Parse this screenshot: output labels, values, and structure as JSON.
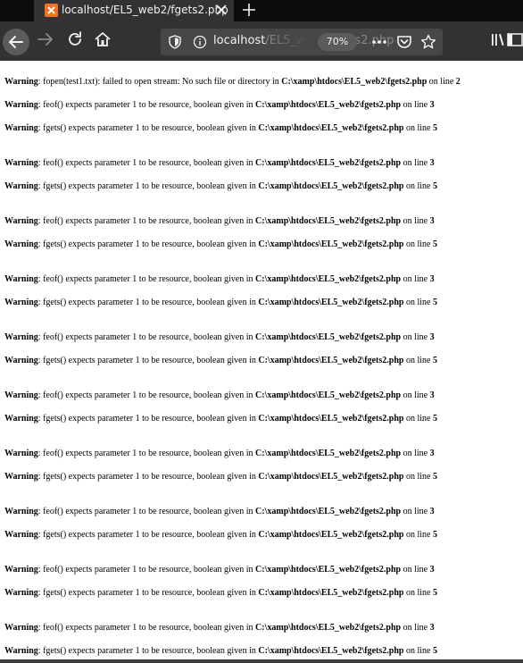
{
  "browser": {
    "tab": {
      "title": "localhost/EL5_web2/fgets2.php"
    },
    "url": {
      "host": "localhost",
      "path": "/EL5_web2/fgets2.php"
    },
    "zoom": "70%",
    "icons": {
      "tab_favicon": "xampp-favicon",
      "tab_close": "close-icon",
      "new_tab": "plus-icon",
      "back": "arrow-left-icon",
      "forward": "arrow-right-icon",
      "reload": "reload-icon",
      "home": "home-icon",
      "tracking": "shield-icon",
      "site_info": "info-icon",
      "page_actions": "more-icon",
      "pocket": "pocket-icon",
      "bookmark": "star-icon",
      "library": "library-icon",
      "sidebar": "sidebar-icon"
    }
  },
  "page": {
    "warnings": [
      {
        "label": "Warning",
        "message": ": fopen(test1.txt): failed to open stream: No such file or directory in ",
        "file": "C:\\xamp\\htdocs\\EL5_web2\\fgets2.php",
        "suffix": " on line ",
        "line": "2"
      },
      {
        "label": "Warning",
        "message": ": feof() expects parameter 1 to be resource, boolean given in ",
        "file": "C:\\xamp\\htdocs\\EL5_web2\\fgets2.php",
        "suffix": " on line ",
        "line": "3"
      },
      {
        "label": "Warning",
        "message": ": fgets() expects parameter 1 to be resource, boolean given in ",
        "file": "C:\\xamp\\htdocs\\EL5_web2\\fgets2.php",
        "suffix": " on line ",
        "line": "5"
      },
      {
        "label": "Warning",
        "message": ": feof() expects parameter 1 to be resource, boolean given in ",
        "file": "C:\\xamp\\htdocs\\EL5_web2\\fgets2.php",
        "suffix": " on line ",
        "line": "3"
      },
      {
        "label": "Warning",
        "message": ": fgets() expects parameter 1 to be resource, boolean given in ",
        "file": "C:\\xamp\\htdocs\\EL5_web2\\fgets2.php",
        "suffix": " on line ",
        "line": "5"
      },
      {
        "label": "Warning",
        "message": ": feof() expects parameter 1 to be resource, boolean given in ",
        "file": "C:\\xamp\\htdocs\\EL5_web2\\fgets2.php",
        "suffix": " on line ",
        "line": "3"
      },
      {
        "label": "Warning",
        "message": ": fgets() expects parameter 1 to be resource, boolean given in ",
        "file": "C:\\xamp\\htdocs\\EL5_web2\\fgets2.php",
        "suffix": " on line ",
        "line": "5"
      },
      {
        "label": "Warning",
        "message": ": feof() expects parameter 1 to be resource, boolean given in ",
        "file": "C:\\xamp\\htdocs\\EL5_web2\\fgets2.php",
        "suffix": " on line ",
        "line": "3"
      },
      {
        "label": "Warning",
        "message": ": fgets() expects parameter 1 to be resource, boolean given in ",
        "file": "C:\\xamp\\htdocs\\EL5_web2\\fgets2.php",
        "suffix": " on line ",
        "line": "5"
      },
      {
        "label": "Warning",
        "message": ": feof() expects parameter 1 to be resource, boolean given in ",
        "file": "C:\\xamp\\htdocs\\EL5_web2\\fgets2.php",
        "suffix": " on line ",
        "line": "3"
      },
      {
        "label": "Warning",
        "message": ": fgets() expects parameter 1 to be resource, boolean given in ",
        "file": "C:\\xamp\\htdocs\\EL5_web2\\fgets2.php",
        "suffix": " on line ",
        "line": "5"
      },
      {
        "label": "Warning",
        "message": ": feof() expects parameter 1 to be resource, boolean given in ",
        "file": "C:\\xamp\\htdocs\\EL5_web2\\fgets2.php",
        "suffix": " on line ",
        "line": "3"
      },
      {
        "label": "Warning",
        "message": ": fgets() expects parameter 1 to be resource, boolean given in ",
        "file": "C:\\xamp\\htdocs\\EL5_web2\\fgets2.php",
        "suffix": " on line ",
        "line": "5"
      },
      {
        "label": "Warning",
        "message": ": feof() expects parameter 1 to be resource, boolean given in ",
        "file": "C:\\xamp\\htdocs\\EL5_web2\\fgets2.php",
        "suffix": " on line ",
        "line": "3"
      },
      {
        "label": "Warning",
        "message": ": fgets() expects parameter 1 to be resource, boolean given in ",
        "file": "C:\\xamp\\htdocs\\EL5_web2\\fgets2.php",
        "suffix": " on line ",
        "line": "5"
      },
      {
        "label": "Warning",
        "message": ": feof() expects parameter 1 to be resource, boolean given in ",
        "file": "C:\\xamp\\htdocs\\EL5_web2\\fgets2.php",
        "suffix": " on line ",
        "line": "3"
      },
      {
        "label": "Warning",
        "message": ": fgets() expects parameter 1 to be resource, boolean given in ",
        "file": "C:\\xamp\\htdocs\\EL5_web2\\fgets2.php",
        "suffix": " on line ",
        "line": "5"
      },
      {
        "label": "Warning",
        "message": ": feof() expects parameter 1 to be resource, boolean given in ",
        "file": "C:\\xamp\\htdocs\\EL5_web2\\fgets2.php",
        "suffix": " on line ",
        "line": "3"
      },
      {
        "label": "Warning",
        "message": ": fgets() expects parameter 1 to be resource, boolean given in ",
        "file": "C:\\xamp\\htdocs\\EL5_web2\\fgets2.php",
        "suffix": " on line ",
        "line": "5"
      },
      {
        "label": "Warning",
        "message": ": feof() expects parameter 1 to be resource, boolean given in ",
        "file": "C:\\xamp\\htdocs\\EL5_web2\\fgets2.php",
        "suffix": " on line ",
        "line": "3"
      },
      {
        "label": "Warning",
        "message": ": fgets() expects parameter 1 to be resource, boolean given in ",
        "file": "C:\\xamp\\htdocs\\EL5_web2\\fgets2.php",
        "suffix": " on line ",
        "line": "5"
      }
    ]
  }
}
